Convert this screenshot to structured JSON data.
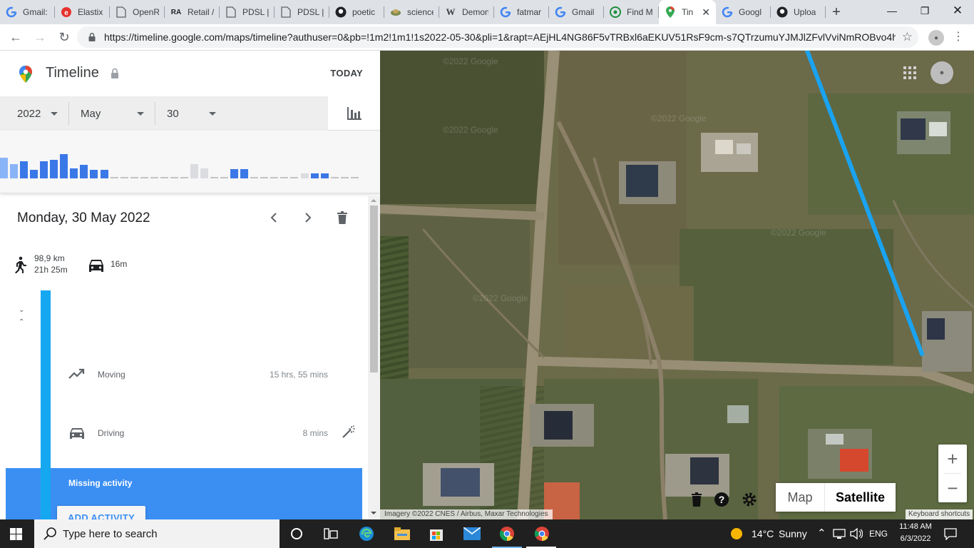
{
  "browser": {
    "tabs": [
      {
        "label": "Gmail:",
        "icon": "google-icon"
      },
      {
        "label": "Elastix",
        "icon": "elastix-icon"
      },
      {
        "label": "OpenR",
        "icon": "document-icon"
      },
      {
        "label": "Retail /",
        "icon": "ra-icon"
      },
      {
        "label": "PDSL |",
        "icon": "document-icon"
      },
      {
        "label": "PDSL |",
        "icon": "document-icon"
      },
      {
        "label": "poetic",
        "icon": "github-icon"
      },
      {
        "label": "science",
        "icon": "science-icon"
      },
      {
        "label": "Demon",
        "icon": "wikipedia-icon"
      },
      {
        "label": "fatmar",
        "icon": "google-icon"
      },
      {
        "label": "Gmail",
        "icon": "google-icon"
      },
      {
        "label": "Find M",
        "icon": "findmy-icon"
      },
      {
        "label": "Tin",
        "icon": "maps-pin-icon",
        "active": true
      },
      {
        "label": "Googl",
        "icon": "google-icon"
      },
      {
        "label": "Uploa",
        "icon": "github-icon"
      }
    ],
    "url": "https://timeline.google.com/maps/timeline?authuser=0&pb=!1m2!1m1!1s2022-05-30&pli=1&rapt=AEjHL4NG86F5vTRBxl6aEKUV51RsF9cm-s7QTrzumuYJMJlZFvlVviNmROBvo4h..."
  },
  "timeline": {
    "title": "Timeline",
    "today_label": "TODAY",
    "year": "2022",
    "month": "May",
    "day": "30",
    "histogram": [
      {
        "v": 0.85,
        "c": "#8ab4f8"
      },
      {
        "v": 0.6,
        "c": "#8ab4f8"
      },
      {
        "v": 0.7,
        "c": "#3b78e7"
      },
      {
        "v": 0.35,
        "c": "#3b78e7"
      },
      {
        "v": 0.7,
        "c": "#3b78e7"
      },
      {
        "v": 0.75,
        "c": "#3b78e7"
      },
      {
        "v": 1.0,
        "c": "#3b78e7"
      },
      {
        "v": 0.4,
        "c": "#3b78e7"
      },
      {
        "v": 0.55,
        "c": "#3b78e7"
      },
      {
        "v": 0.35,
        "c": "#3b78e7"
      },
      {
        "v": 0.35,
        "c": "#3b78e7"
      },
      {
        "v": 0.03,
        "c": "#c4c4c4"
      },
      {
        "v": 0.03,
        "c": "#c4c4c4"
      },
      {
        "v": 0.03,
        "c": "#c4c4c4"
      },
      {
        "v": 0.03,
        "c": "#c4c4c4"
      },
      {
        "v": 0.03,
        "c": "#c4c4c4"
      },
      {
        "v": 0.03,
        "c": "#c4c4c4"
      },
      {
        "v": 0.03,
        "c": "#c4c4c4"
      },
      {
        "v": 0.03,
        "c": "#c4c4c4"
      },
      {
        "v": 0.6,
        "c": "#dadce0"
      },
      {
        "v": 0.4,
        "c": "#dadce0"
      },
      {
        "v": 0.03,
        "c": "#c4c4c4"
      },
      {
        "v": 0.03,
        "c": "#c4c4c4"
      },
      {
        "v": 0.38,
        "c": "#3b78e7"
      },
      {
        "v": 0.38,
        "c": "#3b78e7"
      },
      {
        "v": 0.03,
        "c": "#c4c4c4"
      },
      {
        "v": 0.03,
        "c": "#c4c4c4"
      },
      {
        "v": 0.03,
        "c": "#c4c4c4"
      },
      {
        "v": 0.03,
        "c": "#c4c4c4"
      },
      {
        "v": 0.03,
        "c": "#c4c4c4"
      },
      {
        "v": 0.2,
        "c": "#dadce0"
      },
      {
        "v": 0.2,
        "c": "#3b78e7"
      },
      {
        "v": 0.2,
        "c": "#3b78e7"
      },
      {
        "v": 0.03,
        "c": "#c4c4c4"
      },
      {
        "v": 0.03,
        "c": "#c4c4c4"
      },
      {
        "v": 0.03,
        "c": "#c4c4c4"
      }
    ],
    "day_heading": "Monday, 30 May 2022",
    "summary": {
      "walk_distance": "98,9 km",
      "walk_time": "21h 25m",
      "drive_time": "16m"
    },
    "activities": [
      {
        "label": "Moving",
        "duration": "15 hrs, 55 mins",
        "icon": "trending-icon"
      },
      {
        "label": "Driving",
        "duration": "8 mins",
        "icon": "car-icon"
      }
    ],
    "missing": {
      "title": "Missing activity",
      "button": "ADD ACTIVITY"
    }
  },
  "map": {
    "attribution": "Imagery ©2022 CNES / Airbus, Maxar Technologies",
    "keyboard_shortcuts": "Keyboard shortcuts",
    "map_type": {
      "map": "Map",
      "satellite": "Satellite",
      "selected": "satellite"
    },
    "path_color": "#1aa3f0"
  },
  "taskbar": {
    "search_placeholder": "Type here to search",
    "weather_temp": "14°C",
    "weather_text": "Sunny",
    "language": "ENG",
    "time": "11:48 AM",
    "date": "6/3/2022"
  }
}
